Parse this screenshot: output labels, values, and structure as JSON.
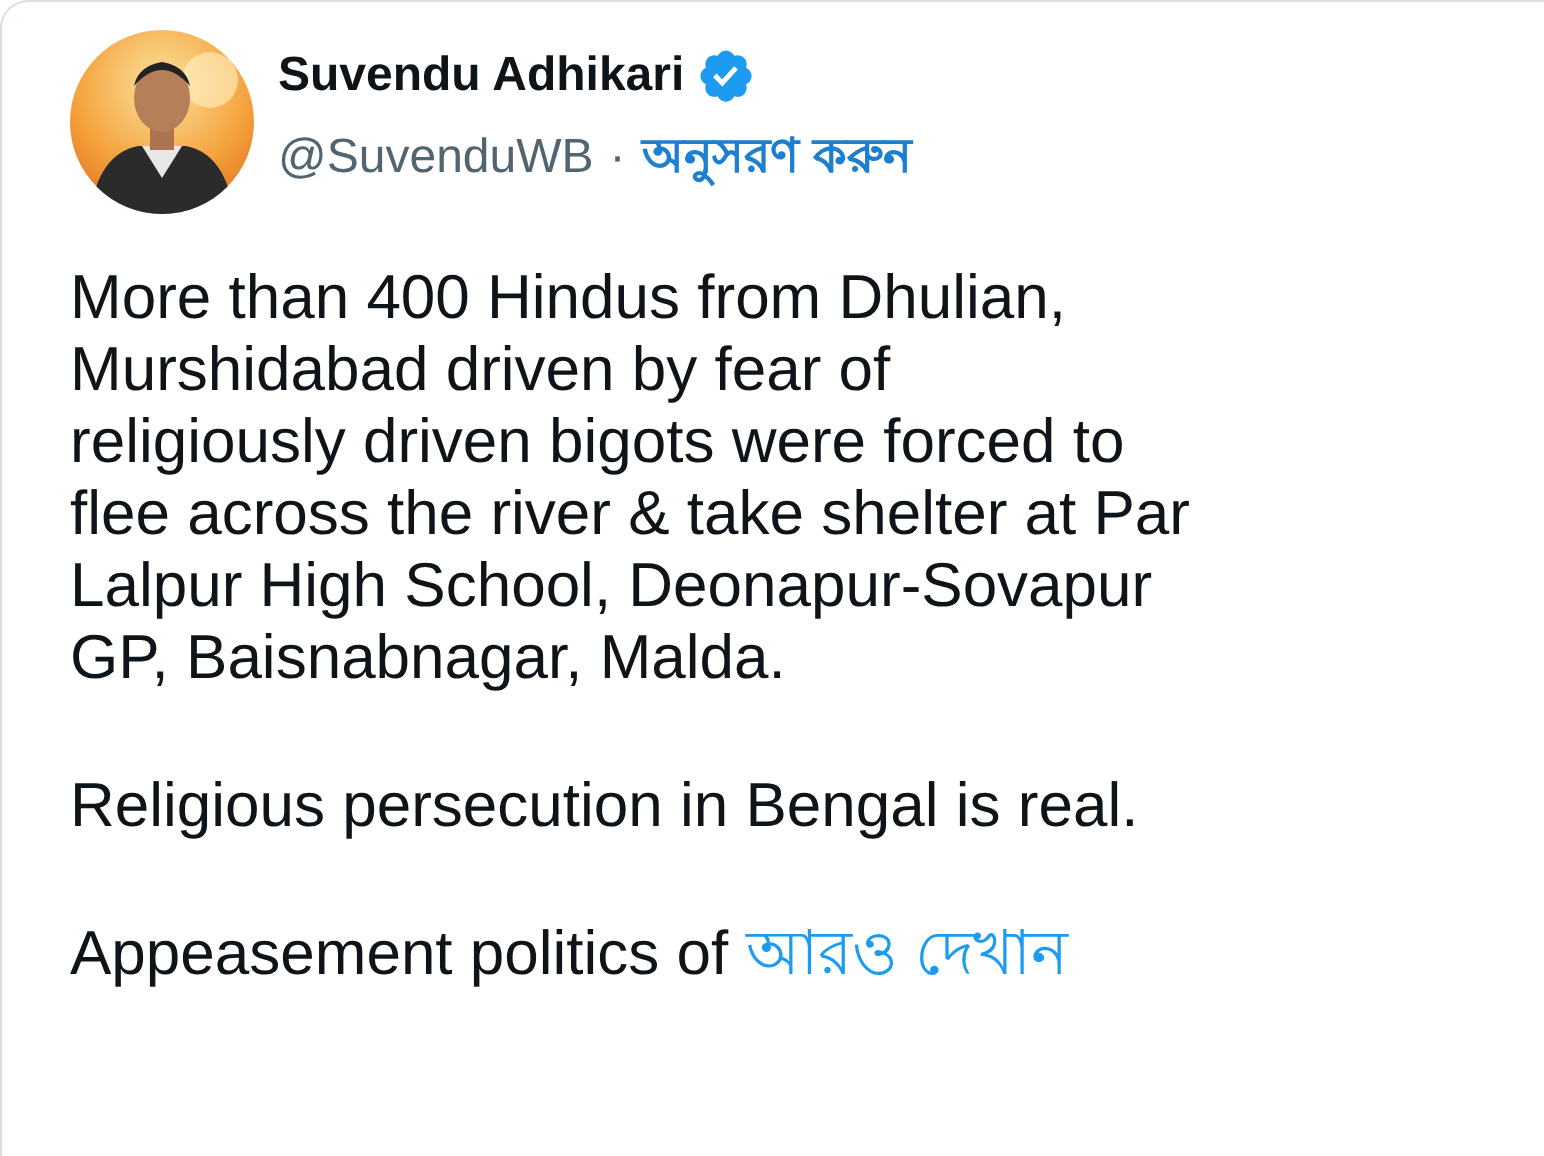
{
  "author": {
    "name": "Suvendu Adhikari",
    "verified": true,
    "handle": "@SuvenduWB",
    "separator": "·",
    "follow": "অনুসরণ করুন"
  },
  "paragraphs": [
    {
      "text": "More than 400 Hindus from Dhulian,\nMurshidabad driven by fear of\nreligiously driven bigots were forced to\nflee across the river & take shelter at Par\nLalpur High School, Deonapur-Sovapur\nGP, Baisnabnagar, Malda."
    },
    {
      "text": "Religious persecution in Bengal is real."
    },
    {
      "text": "Appeasement politics of",
      "more": "আরও দেখান"
    }
  ]
}
